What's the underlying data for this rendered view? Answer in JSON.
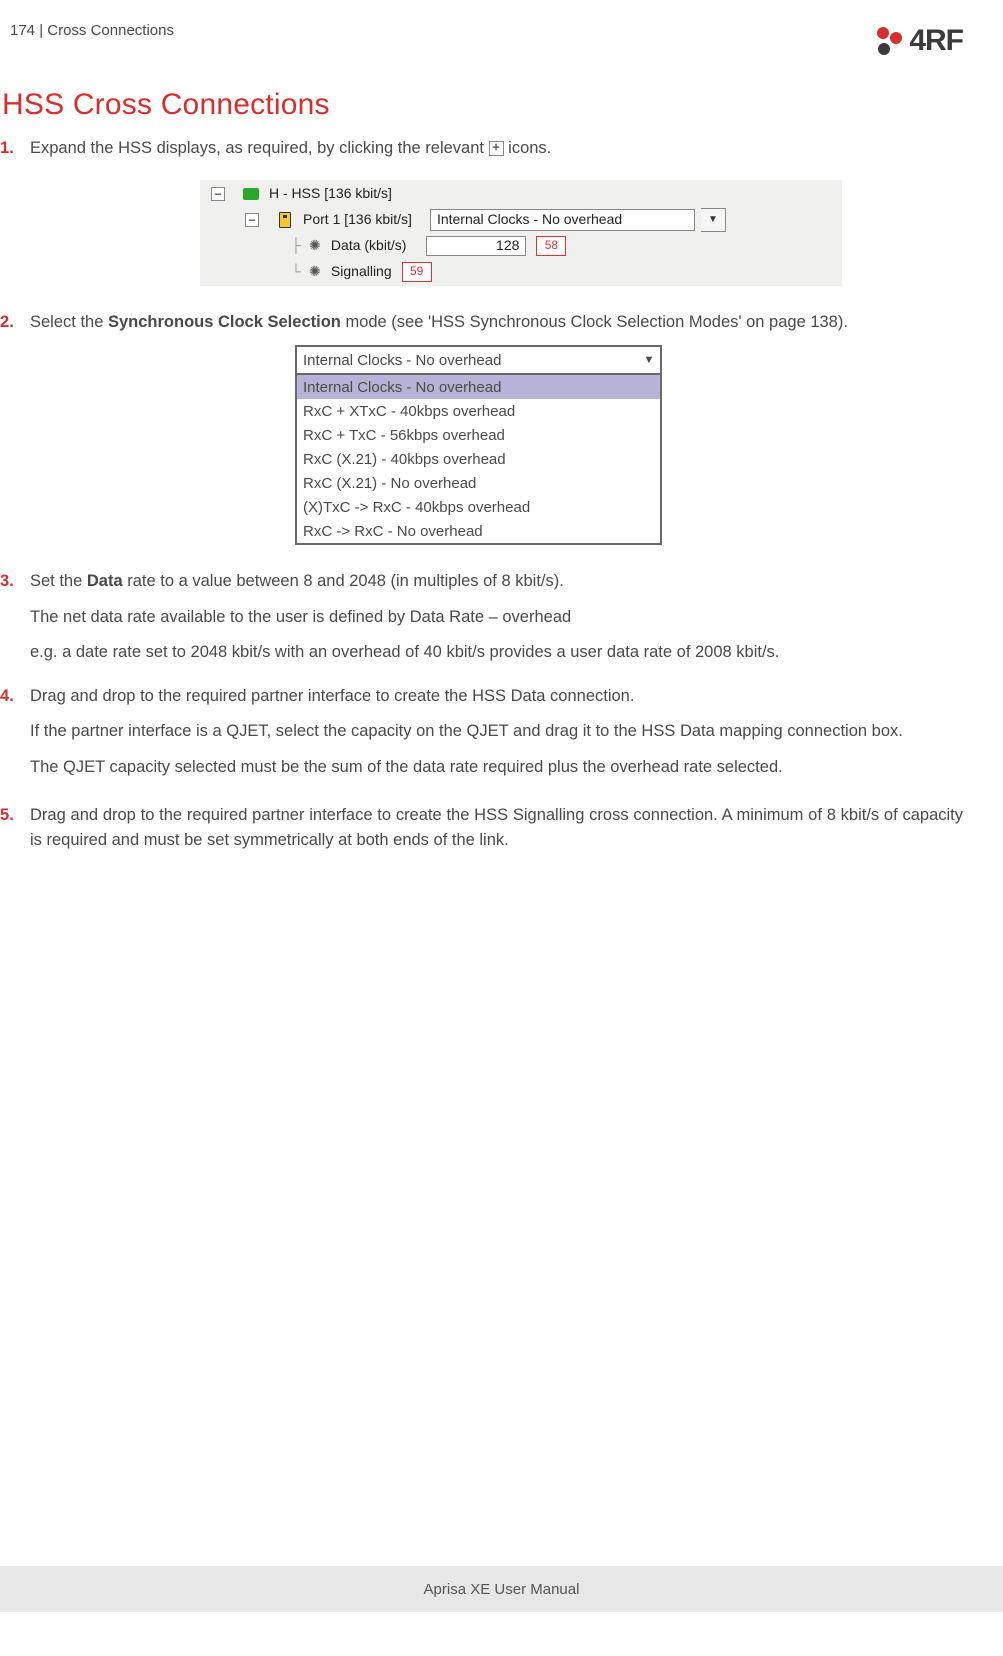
{
  "header": {
    "page_number": "174",
    "separator": "  |  ",
    "section": "Cross Connections",
    "logo_text": "4RF"
  },
  "title": "HSS Cross Connections",
  "steps": {
    "s1": {
      "text_a": "Expand the HSS displays, as required, by clicking the relevant ",
      "text_b": " icons."
    },
    "s2": {
      "text_a": "Select the ",
      "bold": "Synchronous Clock Selection",
      "text_b": " mode (see 'HSS Synchronous Clock Selection Modes' on page 138)."
    },
    "s3": {
      "text_a": "Set the ",
      "bold": "Data",
      "text_b": " rate to a value between 8 and 2048 (in multiples of 8 kbit/s).",
      "p2": "The net data rate available to the user is defined by Data Rate – overhead",
      "p3": "e.g. a date rate set to 2048 kbit/s with an overhead of 40 kbit/s provides a user data rate of 2008 kbit/s."
    },
    "s4": {
      "p1": "Drag and drop to the required partner interface to create the HSS Data connection.",
      "p2": "If the partner interface is a QJET, select the capacity on the QJET and drag it to the HSS Data mapping connection box.",
      "p3": "The QJET capacity selected must be the sum of the data rate required plus the overhead rate selected."
    },
    "s5": {
      "p1": "Drag and drop to the required partner interface to create the HSS Signalling cross connection. A minimum of 8 kbit/s of capacity is required and must be set symmetrically at both ends of the link."
    }
  },
  "fig1": {
    "root_label": "H - HSS [136 kbit/s]",
    "port_label": "Port 1 [136 kbit/s]",
    "clock_selected": "Internal Clocks - No overhead",
    "data_label": "Data (kbit/s)",
    "data_value": "128",
    "data_badge": "58",
    "sig_label": "Signalling",
    "sig_badge": "59"
  },
  "fig2": {
    "selected": "Internal Clocks - No overhead",
    "options": [
      "Internal Clocks - No overhead",
      "RxC + XTxC - 40kbps overhead",
      "RxC + TxC - 56kbps overhead",
      "RxC (X.21) - 40kbps overhead",
      "RxC (X.21) - No overhead",
      "(X)TxC -> RxC - 40kbps overhead",
      "RxC -> RxC - No overhead"
    ]
  },
  "footer": "Aprisa XE User Manual"
}
